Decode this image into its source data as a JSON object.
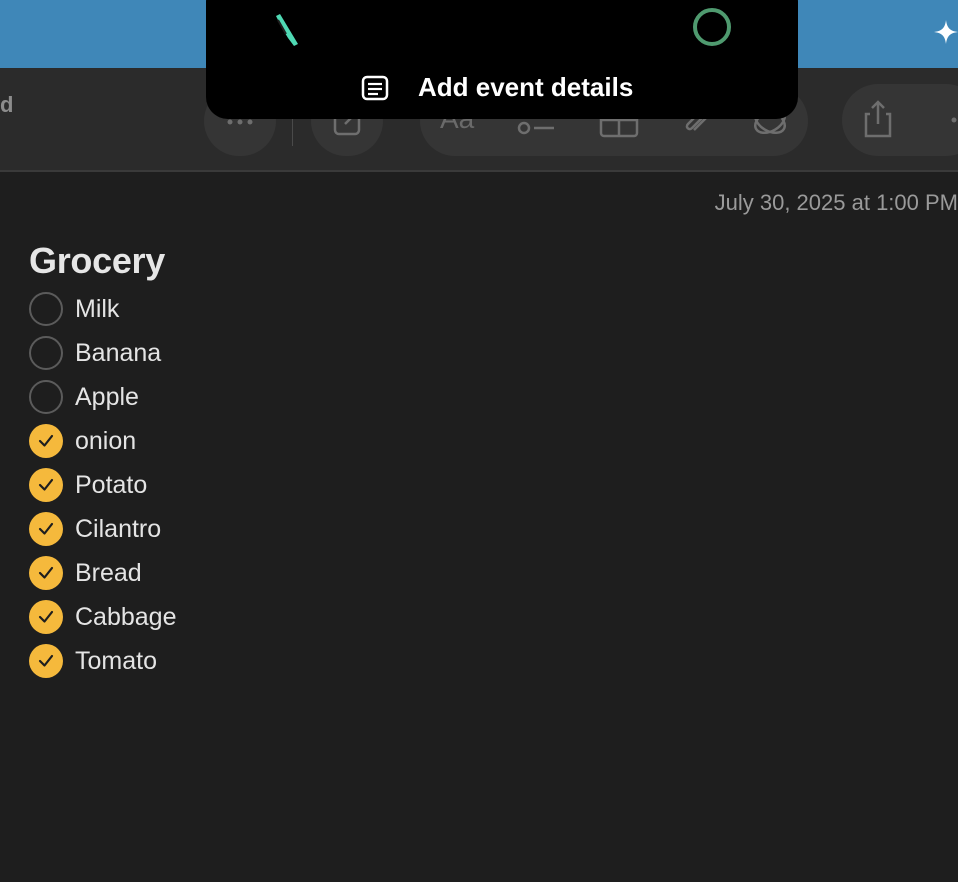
{
  "window": {
    "toolbar_edge_label": "d"
  },
  "notification": {
    "title": "Add event details",
    "icons": [
      "leaf-icon",
      "ring-icon",
      "document-icon"
    ]
  },
  "toolbar": {
    "format_label": "Aa",
    "buttons": [
      "more-icon",
      "compose-icon",
      "format-button",
      "checklist-icon",
      "table-icon",
      "attachment-icon",
      "link-icon",
      "share-icon",
      "more-right-icon"
    ]
  },
  "note": {
    "timestamp": "July 30, 2025 at 1:00 PM",
    "title": "Grocery",
    "items": [
      {
        "label": "Milk",
        "checked": false
      },
      {
        "label": "Banana",
        "checked": false
      },
      {
        "label": "Apple",
        "checked": false
      },
      {
        "label": "onion",
        "checked": true
      },
      {
        "label": "Potato",
        "checked": true
      },
      {
        "label": "Cilantro",
        "checked": true
      },
      {
        "label": "Bread",
        "checked": true
      },
      {
        "label": "Cabbage",
        "checked": true
      },
      {
        "label": "Tomato",
        "checked": true
      }
    ]
  },
  "colors": {
    "desktop_blue": "#3f87b8",
    "background": "#1e1e1e",
    "toolbar": "#2b2b2b",
    "check_accent": "#f5b93c",
    "ring_green": "#4f9a6f"
  }
}
